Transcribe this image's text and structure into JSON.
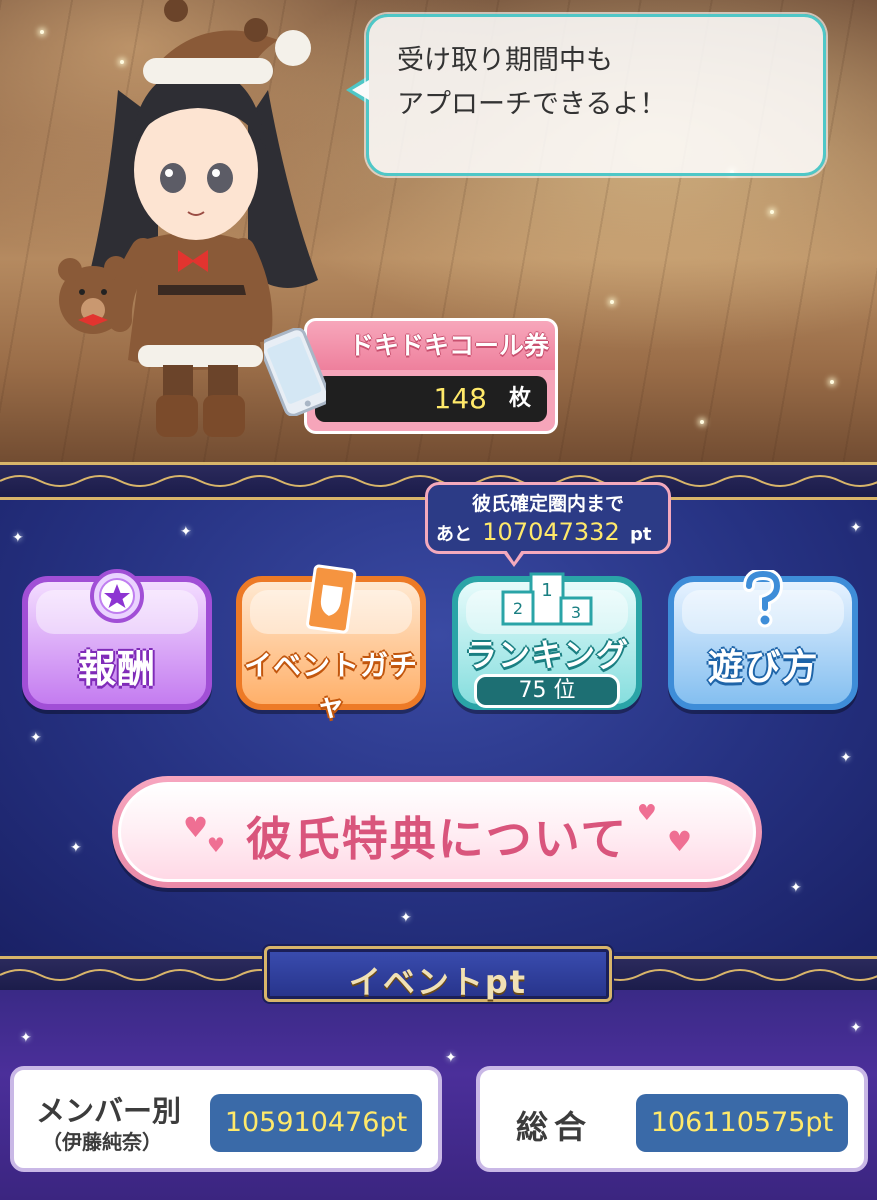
{
  "speech": {
    "line1": "受け取り期間中も",
    "line2": "アプローチできるよ！"
  },
  "ticket": {
    "title": "ドキドキコール券",
    "count": "148",
    "unit": "枚"
  },
  "rank_tip": {
    "title": "彼氏確定圏内まで",
    "prefix": "あと",
    "points": "107047332",
    "suffix": "pt"
  },
  "menu": {
    "reward": "報酬",
    "gacha": "イベントガチャ",
    "ranking": "ランキング",
    "ranking_pos": "75 位",
    "help": "遊び方"
  },
  "perk_button": "彼氏特典について",
  "event_pt": {
    "title": "イベントpt",
    "member_label": "メンバー別",
    "member_name": "（伊藤純奈）",
    "member_value": "105910476pt",
    "total_label": "総合",
    "total_value": "106110575pt"
  },
  "colors": {
    "accent_pink": "#ee7f9c",
    "ranking_teal": "#2aa4a7",
    "navy": "#263282",
    "gold": "#d8b56a",
    "points_yellow": "#ffe96a"
  }
}
